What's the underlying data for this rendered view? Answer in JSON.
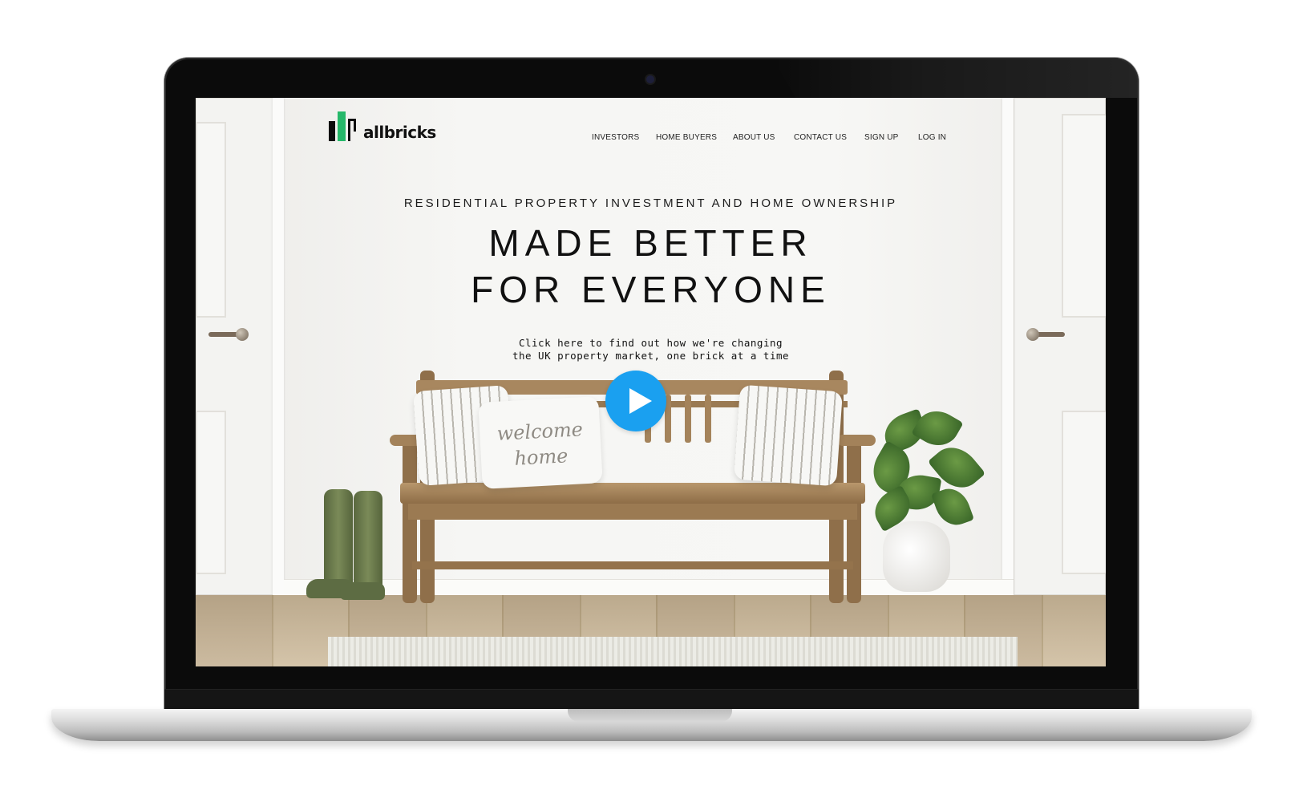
{
  "site": {
    "logo_text": "allbricks",
    "brand_colors": {
      "green": "#26b86a",
      "black": "#0d0d0d",
      "play_blue": "#1aa0f0"
    }
  },
  "nav": {
    "items": [
      {
        "label": "INVESTORS"
      },
      {
        "label": "HOME BUYERS"
      },
      {
        "label": "ABOUT US"
      },
      {
        "label": "CONTACT US"
      },
      {
        "label": "SIGN UP"
      },
      {
        "label": "LOG IN"
      }
    ]
  },
  "hero": {
    "eyebrow": "RESIDENTIAL PROPERTY INVESTMENT AND HOME OWNERSHIP",
    "headline_line1": "MADE BETTER",
    "headline_line2": "FOR EVERYONE",
    "cta_line1": "Click here to find out how we're changing",
    "cta_line2": "the UK property market, one brick at a time",
    "play_icon": "play-icon",
    "pillow_text_line1": "welcome",
    "pillow_text_line2": "home"
  }
}
